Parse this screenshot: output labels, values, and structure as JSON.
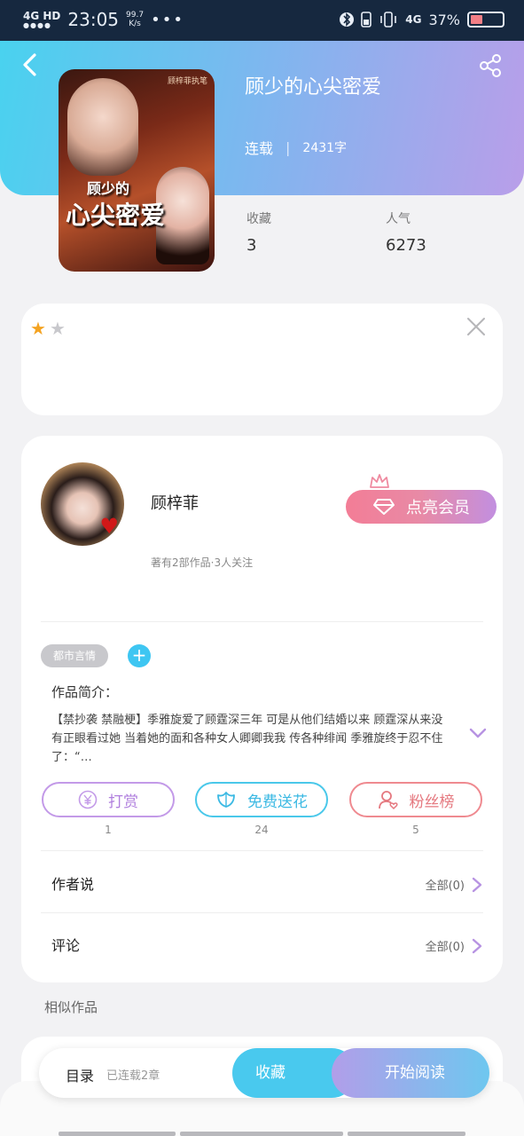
{
  "status_bar": {
    "network": "4G HD",
    "time": "23:05",
    "speed_value": "99.7",
    "speed_unit": "K/s",
    "more": "•••",
    "network_right": "4G",
    "battery_percent": "37%",
    "battery_level": 0.37
  },
  "book": {
    "title": "顾少的心尖密爱",
    "status": "连载",
    "word_count": "2431字",
    "favorites_label": "收藏",
    "favorites_value": "3",
    "popularity_label": "人气",
    "popularity_value": "6273",
    "cover_title_line1": "顾少的",
    "cover_title_line2": "心尖密爱",
    "cover_author_mark": "顾梓菲执笔"
  },
  "rating": {
    "stars_filled": 1,
    "stars_total": 2,
    "star_on": "★",
    "star_off": "★"
  },
  "author": {
    "name": "顾梓菲",
    "meta": "著有2部作品·3人关注",
    "vip_button": "点亮会员"
  },
  "tags": {
    "genre": "都市言情",
    "add": "+"
  },
  "intro": {
    "label": "作品简介：",
    "text": "【禁抄袭 禁融梗】季雅旋爱了顾霆深三年 可是从他们结婚以来 顾霆深从来没有正眼看过她  当着她的面和各种女人卿卿我我 传各种绯闻 季雅旋终于忍不住了：“…"
  },
  "actions": [
    {
      "label": "打赏",
      "count": "1",
      "icon": "yen-coin-icon"
    },
    {
      "label": "免费送花",
      "count": "24",
      "icon": "flower-icon"
    },
    {
      "label": "粉丝榜",
      "count": "5",
      "icon": "fan-user-icon"
    }
  ],
  "sections": {
    "author_says": {
      "title": "作者说",
      "right": "全部(0)"
    },
    "comments": {
      "title": "评论",
      "right": "全部(0)"
    }
  },
  "similar": {
    "label": "相似作品"
  },
  "bottom_bar": {
    "toc": "目录",
    "toc_status": "已连载2章",
    "favorite": "收藏",
    "start_reading": "开始阅读"
  },
  "colors": {
    "header_start": "#49d2ef",
    "header_end": "#b99ee9",
    "accent_blue": "#49c9ee",
    "accent_purple": "#b19ee9",
    "star": "#f4a321"
  }
}
